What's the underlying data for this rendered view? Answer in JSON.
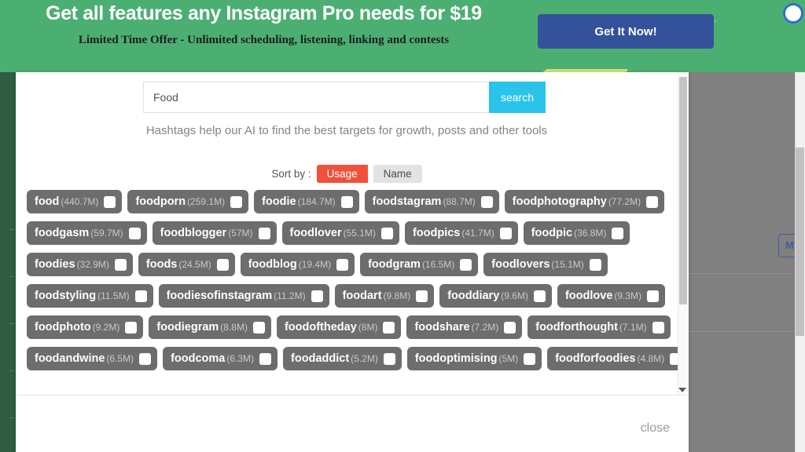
{
  "promo": {
    "title": "Get all features any Instagram Pro needs for $19",
    "subtitle": "Limited Time Offer - Unlimited scheduling, listening, linking and contests",
    "cta_label": "Get It Now!",
    "accent_green": "#4caf72",
    "cta_color": "#34529b"
  },
  "background": {
    "right_button_label": "M T",
    "dim_color": "#808080",
    "sidebar_color": "#2e5d41"
  },
  "modal": {
    "search": {
      "value": "Food",
      "placeholder": "Food",
      "button_label": "search",
      "button_color": "#29c3ec"
    },
    "helper_text": "Hashtags help our AI to find the best targets for growth, posts and other tools",
    "sort": {
      "label": "Sort by :",
      "options": [
        "Usage",
        "Name"
      ],
      "selected": "Usage",
      "active_color": "#f0513a"
    },
    "close_label": "close",
    "chip_color": "#6d6d6d",
    "hashtag_rows": [
      [
        {
          "name": "food",
          "count": "(440.7M)"
        },
        {
          "name": "foodporn",
          "count": "(259.1M)"
        },
        {
          "name": "foodie",
          "count": "(184.7M)"
        },
        {
          "name": "foodstagram",
          "count": "(88.7M)"
        },
        {
          "name": "foodphotography",
          "count": "(77.2M)"
        }
      ],
      [
        {
          "name": "foodgasm",
          "count": "(59.7M)"
        },
        {
          "name": "foodblogger",
          "count": "(57M)"
        },
        {
          "name": "foodlover",
          "count": "(55.1M)"
        },
        {
          "name": "foodpics",
          "count": "(41.7M)"
        },
        {
          "name": "foodpic",
          "count": "(36.8M)"
        }
      ],
      [
        {
          "name": "foodies",
          "count": "(32.9M)"
        },
        {
          "name": "foods",
          "count": "(24.5M)"
        },
        {
          "name": "foodblog",
          "count": "(19.4M)"
        },
        {
          "name": "foodgram",
          "count": "(16.5M)"
        },
        {
          "name": "foodlovers",
          "count": "(15.1M)"
        }
      ],
      [
        {
          "name": "foodstyling",
          "count": "(11.5M)"
        },
        {
          "name": "foodiesofinstagram",
          "count": "(11.2M)"
        },
        {
          "name": "foodart",
          "count": "(9.8M)"
        },
        {
          "name": "fooddiary",
          "count": "(9.6M)"
        },
        {
          "name": "foodlove",
          "count": "(9.3M)"
        }
      ],
      [
        {
          "name": "foodphoto",
          "count": "(9.2M)"
        },
        {
          "name": "foodiegram",
          "count": "(8.8M)"
        },
        {
          "name": "foodoftheday",
          "count": "(8M)"
        },
        {
          "name": "foodshare",
          "count": "(7.2M)"
        },
        {
          "name": "foodforthought",
          "count": "(7.1M)"
        }
      ],
      [
        {
          "name": "foodandwine",
          "count": "(6.5M)"
        },
        {
          "name": "foodcoma",
          "count": "(6.3M)"
        },
        {
          "name": "foodaddict",
          "count": "(5.2M)"
        },
        {
          "name": "foodoptimising",
          "count": "(5M)"
        },
        {
          "name": "foodforfoodies",
          "count": "(4.8M)"
        }
      ]
    ]
  }
}
